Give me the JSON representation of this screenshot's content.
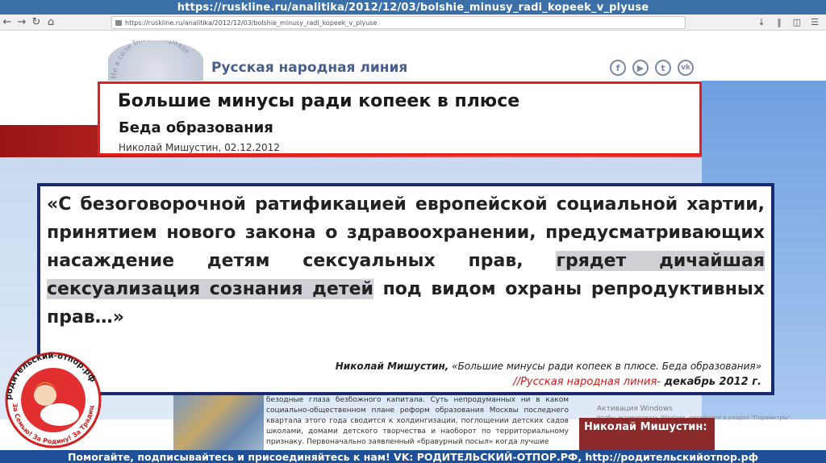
{
  "overlay_url": "https://ruskline.ru/analitika/2012/12/03/bolshie_minusy_radi_kopeek_v_plyuse",
  "browser": {
    "address": "https://ruskline.ru/analitika/2012/12/03/bolshie_minusy_radi_kopeek_v_plyuse"
  },
  "site": {
    "name": "Русская народная линия",
    "seal_text": "Не в силе Бог, а в правде",
    "social_icons": [
      "facebook-icon",
      "youtube-icon",
      "twitter-icon",
      "vk-icon"
    ]
  },
  "article": {
    "title": "Большие минусы ради копеек в плюсе",
    "subtitle": "Беда образования",
    "author_date": "Николай Мишустин, 02.12.2012"
  },
  "quote": {
    "text_before": "«С безоговорочной ратификацией европейской социальной хартии, принятием нового закона о здравоохранении, предусматривающих насаждение детям сексуальных прав, ",
    "highlight": "грядет дичайшая сексуализация сознания детей",
    "text_after": " под видом охраны репродуктивных прав…»",
    "cite_author": "Николай Мишустин,",
    "cite_work": " «Большие минусы ради копеек в плюсе. Беда образования»",
    "cite_source": "//Русская народная линия-",
    "cite_date": " декабрь 2012 г."
  },
  "background_text": "безодные глаза безбожного капитала. Суть непродуманных ни в каком социально-общественном плане реформ образования Москвы последнего квартала этого года сводится к холдингизации, поглощении детских садов школами, домами детского творчества и наоборот по территориальному признаку. Первоначально заявленный «бравурный посыл» когда лучшие",
  "windows_activation": {
    "title": "Активация Windows",
    "hint": "Чтобы активировать Windows, перейдите в раздел \"Параметры\"."
  },
  "sidebar_author": "Николай Мишустин:",
  "stamp": {
    "ring_text": "родительский-отпор.рф",
    "motto": "За Семью! За Родину! За Традиции!"
  },
  "banner": "Помогайте, подписывайтесь и присоединяйтесь к нам! VK: РОДИТЕЛЬСКИЙ-ОТПОР.РФ, http://родительскийотпор.рф",
  "colors": {
    "accent_red": "#e02020",
    "quote_border": "#1b2a6e",
    "banner_bg": "#1f4f96"
  }
}
